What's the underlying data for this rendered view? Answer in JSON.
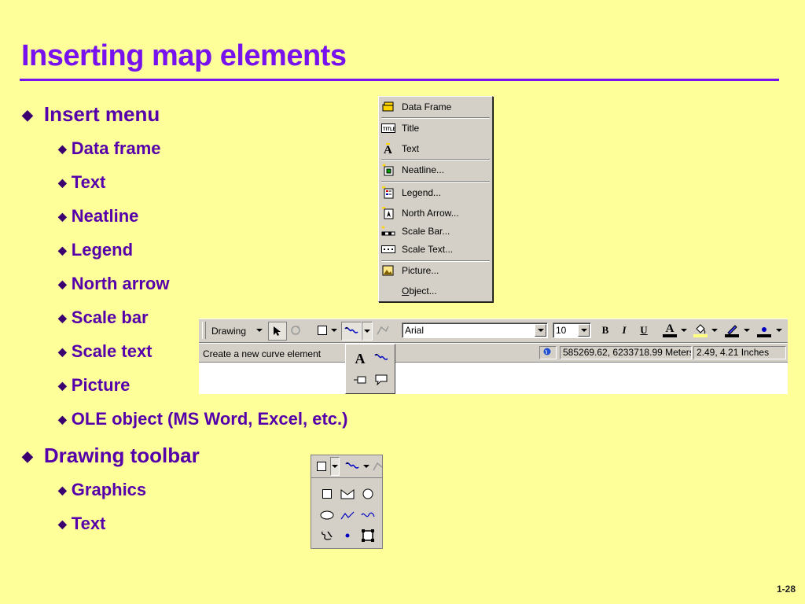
{
  "slide": {
    "title": "Inserting map elements",
    "page_number": "1-28",
    "bullets": [
      {
        "label": "Insert menu",
        "children": [
          "Data frame",
          "Text",
          "Neatline",
          "Legend",
          "North arrow",
          "Scale bar",
          "Scale text",
          "Picture",
          "OLE object (MS Word, Excel, etc.)"
        ]
      },
      {
        "label": "Drawing toolbar",
        "children": [
          "Graphics",
          "Text"
        ]
      }
    ]
  },
  "insert_menu": {
    "items": [
      "Data Frame",
      "Title",
      "Text",
      "Neatline...",
      "Legend...",
      "North Arrow...",
      "Scale Bar...",
      "Scale Text...",
      "Picture...",
      "Object..."
    ],
    "icons": [
      "data-frame-icon",
      "title-icon",
      "text-icon",
      "neatline-icon",
      "legend-icon",
      "north-arrow-icon",
      "scale-bar-icon",
      "scale-text-icon",
      "picture-icon",
      ""
    ]
  },
  "drawing_toolbar": {
    "label": "Drawing",
    "font_name": "Arial",
    "font_size": "10",
    "bold": "B",
    "italic": "I",
    "underline": "U",
    "font_color_glyph": "A",
    "text_tool_glyph": "A"
  },
  "status_bar": {
    "message": "Create a new curve element",
    "map_coords": "585269.62, 6233718.99 Meters",
    "page_coords": "2.49, 4.21 Inches"
  },
  "colors": {
    "background": "#ffff99",
    "title": "#7711ee",
    "bullet_text": "#5500aa",
    "ui_face": "#d4d0c8"
  }
}
